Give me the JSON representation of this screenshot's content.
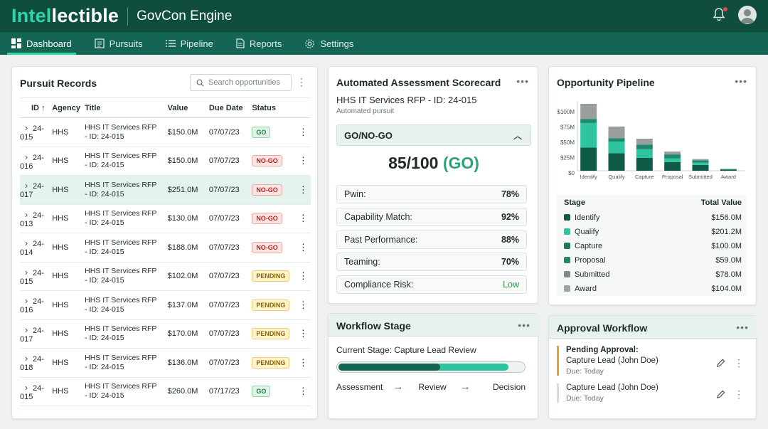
{
  "app": {
    "logo_part1": "Intel",
    "logo_part2": "lectible",
    "product": "GovCon Engine"
  },
  "nav": [
    {
      "label": "Dashboard",
      "icon": "dashboard-icon",
      "active": true
    },
    {
      "label": "Pursuits",
      "icon": "pursuits-icon"
    },
    {
      "label": "Pipeline",
      "icon": "pipeline-icon"
    },
    {
      "label": "Reports",
      "icon": "reports-icon"
    },
    {
      "label": "Settings",
      "icon": "gear-icon"
    }
  ],
  "records": {
    "title": "Pursuit Records",
    "search_placeholder": "Search opportunities",
    "columns": [
      "ID",
      "Agency",
      "Title",
      "Value",
      "Due Date",
      "Status"
    ],
    "rows": [
      {
        "id": "24-015",
        "agency": "HHS",
        "title": "HHS IT Services RFP - ID: 24-015",
        "value": "$150.0M",
        "due": "07/07/23",
        "status": "GO"
      },
      {
        "id": "24-016",
        "agency": "HHS",
        "title": "HHS IT Services RFP - ID: 24-015",
        "value": "$150.0M",
        "due": "07/07/23",
        "status": "NO-GO"
      },
      {
        "id": "24-017",
        "agency": "HHS",
        "title": "HHS IT Services RFP - ID: 24-015",
        "value": "$251.0M",
        "due": "07/07/23",
        "status": "NO-GO"
      },
      {
        "id": "24-013",
        "agency": "HHS",
        "title": "HHS IT Services RFP - ID: 24-015",
        "value": "$130.0M",
        "due": "07/07/23",
        "status": "NO-GO"
      },
      {
        "id": "24-014",
        "agency": "HHS",
        "title": "HHS IT Services RFP - ID: 24-015",
        "value": "$188.0M",
        "due": "07/07/23",
        "status": "NO-GO"
      },
      {
        "id": "24-015",
        "agency": "HHS",
        "title": "HHS IT Services RFP - ID: 24-015",
        "value": "$102.0M",
        "due": "07/07/23",
        "status": "PENDING"
      },
      {
        "id": "24-016",
        "agency": "HHS",
        "title": "HHS IT Services RFP - ID: 24-015",
        "value": "$137.0M",
        "due": "07/07/23",
        "status": "PENDING"
      },
      {
        "id": "24-017",
        "agency": "HHS",
        "title": "HHS IT Services RFP - ID: 24-015",
        "value": "$170.0M",
        "due": "07/07/23",
        "status": "PENDING"
      },
      {
        "id": "24-018",
        "agency": "HHS",
        "title": "HHS IT Services RFP - ID: 24-015",
        "value": "$136.0M",
        "due": "07/07/23",
        "status": "PENDING"
      },
      {
        "id": "24-015",
        "agency": "HHS",
        "title": "HHS IT Services RFP - ID: 24-015",
        "value": "$260.0M",
        "due": "07/17/23",
        "status": "GO"
      }
    ]
  },
  "scorecard": {
    "title": "Automated Assessment Scorecard",
    "subtitle": "HHS IT Services RFP - ID: 24-015",
    "subtitle2": "Automated pursuit",
    "section": "GO/NO-GO",
    "score": "85/100",
    "verdict": "(GO)",
    "metrics": [
      {
        "label": "Pwin:",
        "value": "78%"
      },
      {
        "label": "Capability Match:",
        "value": "92%"
      },
      {
        "label": "Past Performance:",
        "value": "88%"
      },
      {
        "label": "Teaming:",
        "value": "70%"
      },
      {
        "label": "Compliance Risk:",
        "value": "Low"
      }
    ]
  },
  "pipeline": {
    "title": "Opportunity Pipeline",
    "table_headers": [
      "Stage",
      "Total Value"
    ],
    "stages": [
      {
        "name": "Identify",
        "value": "$156.0M",
        "color": "#0f5b47"
      },
      {
        "name": "Qualify",
        "value": "$201.2M",
        "color": "#2ec4a0"
      },
      {
        "name": "Capture",
        "value": "$100.0M",
        "color": "#177a61"
      },
      {
        "name": "Proposal",
        "value": "$59.0M",
        "color": "#1b8a6d"
      },
      {
        "name": "Submitted",
        "value": "$78.0M",
        "color": "#7d8d88"
      },
      {
        "name": "Award",
        "value": "$104.0M",
        "color": "#9ca29f"
      }
    ]
  },
  "chart_data": {
    "type": "bar",
    "stacked": true,
    "categories": [
      "Identify",
      "Qualify",
      "Capture",
      "Proposal",
      "Submitted",
      "Award"
    ],
    "yticks": [
      "$100M",
      "$75M",
      "$50M",
      "$25M",
      "$0"
    ],
    "ylim": [
      0,
      110
    ],
    "series": [
      {
        "color": "#0f5b47",
        "values": [
          40,
          30,
          22,
          15,
          10,
          2
        ]
      },
      {
        "color": "#2ec4a0",
        "values": [
          42,
          20,
          15,
          6,
          4,
          0
        ]
      },
      {
        "color": "#1b8a6d",
        "values": [
          7,
          6,
          8,
          7,
          4,
          1
        ]
      },
      {
        "color": "#9a9f9d",
        "values": [
          26,
          20,
          10,
          5,
          2,
          0
        ]
      }
    ],
    "grid": false,
    "title": "",
    "xlabel": "",
    "ylabel": ""
  },
  "workflow": {
    "title": "Workflow Stage",
    "current": "Current Stage: Capture Lead Review",
    "progress_pct": 92,
    "progress_dark_pct": 55,
    "steps": [
      "Assessment",
      "Review",
      "Decision"
    ]
  },
  "approval": {
    "title": "Approval Workflow",
    "items": [
      {
        "label": "Pending Approval:",
        "who": "Capture Lead (John Doe)",
        "due": "Due: Today"
      },
      {
        "who": "Capture Lead (John Doe)",
        "due": "Due: Today"
      }
    ]
  }
}
